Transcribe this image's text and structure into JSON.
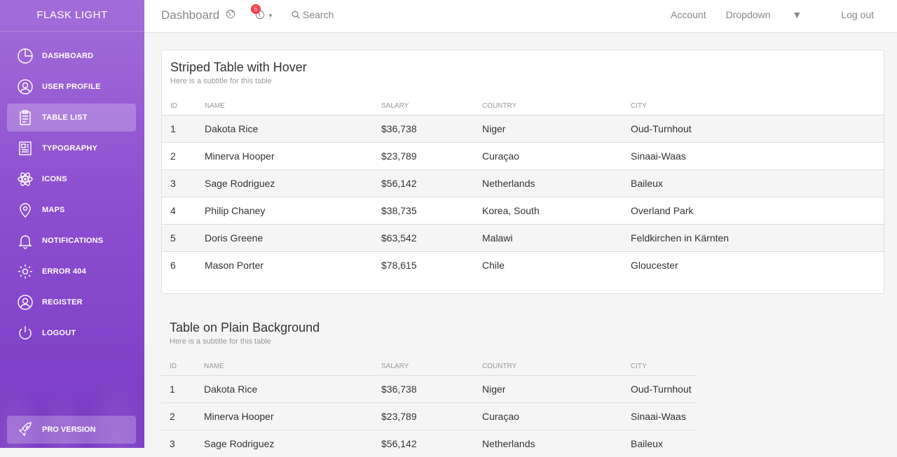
{
  "sidebar": {
    "brand": "FLASK LIGHT",
    "items": [
      {
        "label": "DASHBOARD",
        "icon": "pie-chart-icon"
      },
      {
        "label": "USER PROFILE",
        "icon": "user-circle-icon"
      },
      {
        "label": "TABLE LIST",
        "icon": "clipboard-icon"
      },
      {
        "label": "TYPOGRAPHY",
        "icon": "newspaper-icon"
      },
      {
        "label": "ICONS",
        "icon": "atom-icon"
      },
      {
        "label": "MAPS",
        "icon": "map-pin-icon"
      },
      {
        "label": "NOTIFICATIONS",
        "icon": "bell-icon"
      },
      {
        "label": "ERROR 404",
        "icon": "gear-icon"
      },
      {
        "label": "REGISTER",
        "icon": "user-circle-icon"
      },
      {
        "label": "LOGOUT",
        "icon": "power-icon"
      }
    ],
    "active": "TABLE LIST",
    "pro": {
      "label": "PRO VERSION",
      "icon": "rocket-icon"
    }
  },
  "topbar": {
    "title": "Dashboard",
    "notification_count": "5",
    "search_label": "Search",
    "links": [
      "Account",
      "Dropdown",
      "Log out"
    ]
  },
  "striped_table": {
    "title": "Striped Table with Hover",
    "subtitle": "Here is a subtitle for this table",
    "headers": [
      "ID",
      "NAME",
      "SALARY",
      "COUNTRY",
      "CITY"
    ],
    "rows": [
      [
        "1",
        "Dakota Rice",
        "$36,738",
        "Niger",
        "Oud-Turnhout"
      ],
      [
        "2",
        "Minerva Hooper",
        "$23,789",
        "Curaçao",
        "Sinaai-Waas"
      ],
      [
        "3",
        "Sage Rodriguez",
        "$56,142",
        "Netherlands",
        "Baileux"
      ],
      [
        "4",
        "Philip Chaney",
        "$38,735",
        "Korea, South",
        "Overland Park"
      ],
      [
        "5",
        "Doris Greene",
        "$63,542",
        "Malawi",
        "Feldkirchen in Kärnten"
      ],
      [
        "6",
        "Mason Porter",
        "$78,615",
        "Chile",
        "Gloucester"
      ]
    ]
  },
  "plain_table": {
    "title": "Table on Plain Background",
    "subtitle": "Here is a subtitle for this table",
    "headers": [
      "ID",
      "NAME",
      "SALARY",
      "COUNTRY",
      "CITY"
    ],
    "rows": [
      [
        "1",
        "Dakota Rice",
        "$36,738",
        "Niger",
        "Oud-Turnhout"
      ],
      [
        "2",
        "Minerva Hooper",
        "$23,789",
        "Curaçao",
        "Sinaai-Waas"
      ],
      [
        "3",
        "Sage Rodriguez",
        "$56,142",
        "Netherlands",
        "Baileux"
      ]
    ]
  },
  "colors": {
    "sidebar_top": "#a26dd8",
    "sidebar_bottom": "#7a3bc4",
    "badge": "#fb404b"
  }
}
